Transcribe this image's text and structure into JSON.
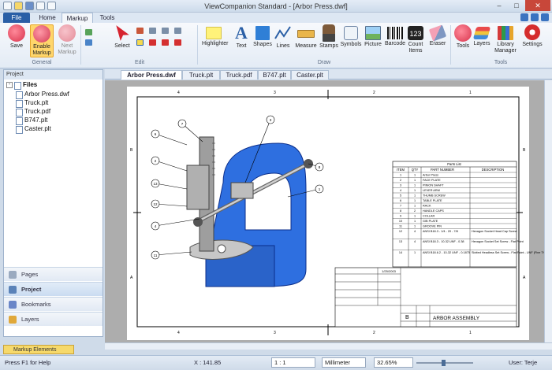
{
  "window": {
    "title": "ViewCompanion Standard - [Arbor Press.dwf]"
  },
  "menu_tabs": {
    "file": "File",
    "home": "Home",
    "markup": "Markup",
    "tools": "Tools"
  },
  "ribbon": {
    "save": "Save",
    "enable_markup": "Enable Markup",
    "next_markup": "Next Markup",
    "select": "Select",
    "highlighter": "Highlighter",
    "text": "Text",
    "shapes": "Shapes",
    "lines": "Lines",
    "measure": "Measure",
    "stamps": "Stamps",
    "symbols": "Symbols",
    "picture": "Picture",
    "barcode": "Barcode",
    "count_items": "Count Items",
    "eraser": "Eraser",
    "tools": "Tools",
    "layers": "Layers",
    "library_manager": "Library Manager",
    "settings": "Settings",
    "group_general": "General",
    "group_edit": "Edit",
    "group_draw": "Draw",
    "group_tools": "Tools"
  },
  "doc_tabs": [
    "Arbor Press.dwf",
    "Truck.plt",
    "Truck.pdf",
    "B747.plt",
    "Caster.plt"
  ],
  "left_panel": {
    "header": "Project",
    "root": "Files",
    "files": [
      "Arbor Press.dwf",
      "Truck.plt",
      "Truck.pdf",
      "B747.plt",
      "Caster.plt"
    ],
    "nav": [
      "Pages",
      "Project",
      "Bookmarks",
      "Layers"
    ]
  },
  "bottom_tab": "Markup Elements",
  "drawing": {
    "parts_title": "Parts List",
    "col_item": "ITEM",
    "col_qty": "QTY",
    "col_part": "PART NUMBER",
    "col_desc": "DESCRIPTION",
    "rows": [
      [
        "1",
        "1",
        "Arbor Press",
        ""
      ],
      [
        "2",
        "1",
        "FACE PLATE",
        ""
      ],
      [
        "3",
        "1",
        "PINION SHAFT",
        ""
      ],
      [
        "4",
        "1",
        "LEVER ARM",
        ""
      ],
      [
        "5",
        "1",
        "THUMB SCREW",
        ""
      ],
      [
        "6",
        "1",
        "TABLE PLATE",
        ""
      ],
      [
        "7",
        "1",
        "RACK",
        ""
      ],
      [
        "8",
        "2",
        "HANDLE CAPS",
        ""
      ],
      [
        "9",
        "1",
        "COLLAR",
        ""
      ],
      [
        "10",
        "1",
        "GIB PLATE",
        ""
      ],
      [
        "11",
        "1",
        "GROOVE PIN",
        ""
      ],
      [
        "12",
        "4",
        "ANSI B18.3 - 1/4 - 20 - 7/8",
        "Hexagon Socket Head Cap Screw"
      ],
      [
        "13",
        "4",
        "ANSI B18.3 - 10-32 UNF - 0.38",
        "Hexagon Socket Set Screw - Flat Point"
      ],
      [
        "14",
        "1",
        "ANSI B18.6.2 - 10-32 UNF - 0.1875",
        "Slotted Headless Set Screw - Flat Point - UNF (Fine Thread - inch)"
      ]
    ],
    "assembly_title": "ARBOR ASSEMBLY",
    "date": "1/25/2003",
    "size": "B",
    "balloons": [
      "7",
      "3",
      "6",
      "2",
      "13",
      "12",
      "4",
      "11",
      "8",
      "1"
    ]
  },
  "status": {
    "help": "Press F1 for Help",
    "x": "X : 141.85",
    "scale": "1 : 1",
    "unit": "Millimeter",
    "zoom": "32.65%",
    "user": "User: Terje"
  }
}
